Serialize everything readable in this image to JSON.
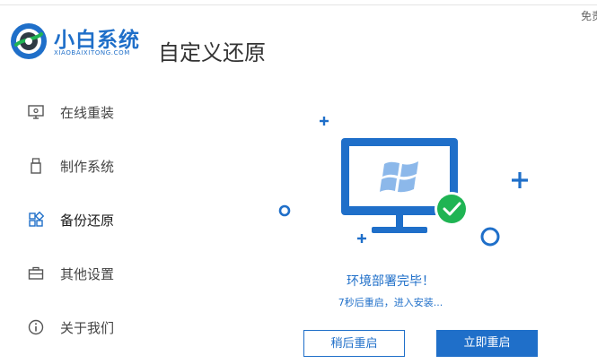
{
  "app": {
    "logo_title": "小白系统",
    "logo_subtitle": "XIAOBAIXITONG.COM",
    "top_right_text": "免责"
  },
  "page": {
    "title": "自定义还原"
  },
  "sidebar": {
    "items": [
      {
        "label": "在线重装",
        "icon": "monitor-icon"
      },
      {
        "label": "制作系统",
        "icon": "usb-drive-icon"
      },
      {
        "label": "备份还原",
        "icon": "backup-grid-icon",
        "active": true
      },
      {
        "label": "其他设置",
        "icon": "briefcase-icon"
      },
      {
        "label": "关于我们",
        "icon": "info-icon"
      }
    ]
  },
  "status": {
    "title": "环境部署完毕！",
    "message": "7秒后重启，进入安装..."
  },
  "buttons": {
    "later": "稍后重启",
    "now": "立即重启"
  },
  "colors": {
    "accent": "#1f6fc9",
    "success": "#1fb453"
  }
}
